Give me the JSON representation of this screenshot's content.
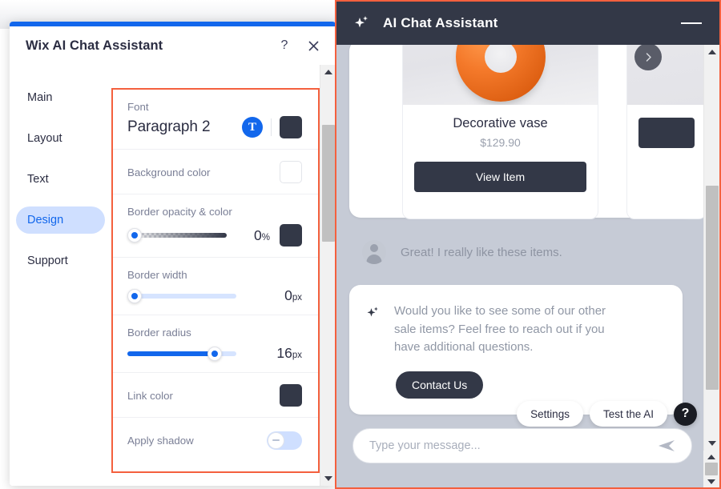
{
  "wix_dialog": {
    "title": "Wix AI Chat Assistant",
    "help_icon": "question-mark-icon",
    "close_icon": "close-icon",
    "nav": {
      "items": [
        {
          "label": "Main",
          "active": false
        },
        {
          "label": "Layout",
          "active": false
        },
        {
          "label": "Text",
          "active": false
        },
        {
          "label": "Design",
          "active": true
        },
        {
          "label": "Support",
          "active": false
        }
      ]
    },
    "settings": {
      "font": {
        "label": "Font",
        "value": "Paragraph 2",
        "text_badge": "T",
        "color": "#333847"
      },
      "background_color": {
        "label": "Background color",
        "color": "#ffffff"
      },
      "border_opacity_color": {
        "label": "Border opacity & color",
        "value": "0",
        "unit": "%",
        "percent": 0,
        "color": "#333847"
      },
      "border_width": {
        "label": "Border width",
        "value": "0",
        "unit": "px",
        "percent": 0
      },
      "border_radius": {
        "label": "Border radius",
        "value": "16",
        "unit": "px",
        "percent": 75
      },
      "link_color": {
        "label": "Link color",
        "color": "#333847"
      },
      "apply_shadow": {
        "label": "Apply shadow",
        "enabled": false
      }
    },
    "scrollbar": {
      "up_icon": "scroll-up-arrow-icon",
      "down_icon": "scroll-down-arrow-icon"
    }
  },
  "chat_widget": {
    "header": {
      "title": "AI Chat Assistant",
      "sparkle_icon": "sparkle-icon",
      "minimize_icon": "minimize-icon"
    },
    "product_card": {
      "title": "Decorative vase",
      "price": "$129.90",
      "button": "View Item",
      "next_icon": "chevron-right-icon"
    },
    "user_message": {
      "avatar_icon": "user-avatar-icon",
      "text": "Great! I really like these items."
    },
    "ai_message": {
      "sparkle_icon": "sparkle-icon",
      "text": "Would you like to see some of our other sale items? Feel free to reach out if you have additional questions.",
      "button": "Contact Us"
    },
    "actions": {
      "settings": "Settings",
      "test_ai": "Test the AI",
      "help_icon": "help-question-icon"
    },
    "composer": {
      "placeholder": "Type your message...",
      "send_icon": "send-paper-plane-icon"
    }
  },
  "colors": {
    "accent_blue": "#1267ec",
    "highlight_orange": "#f4603e",
    "dark_navy": "#333847",
    "chat_bg": "#c6cbd6"
  }
}
